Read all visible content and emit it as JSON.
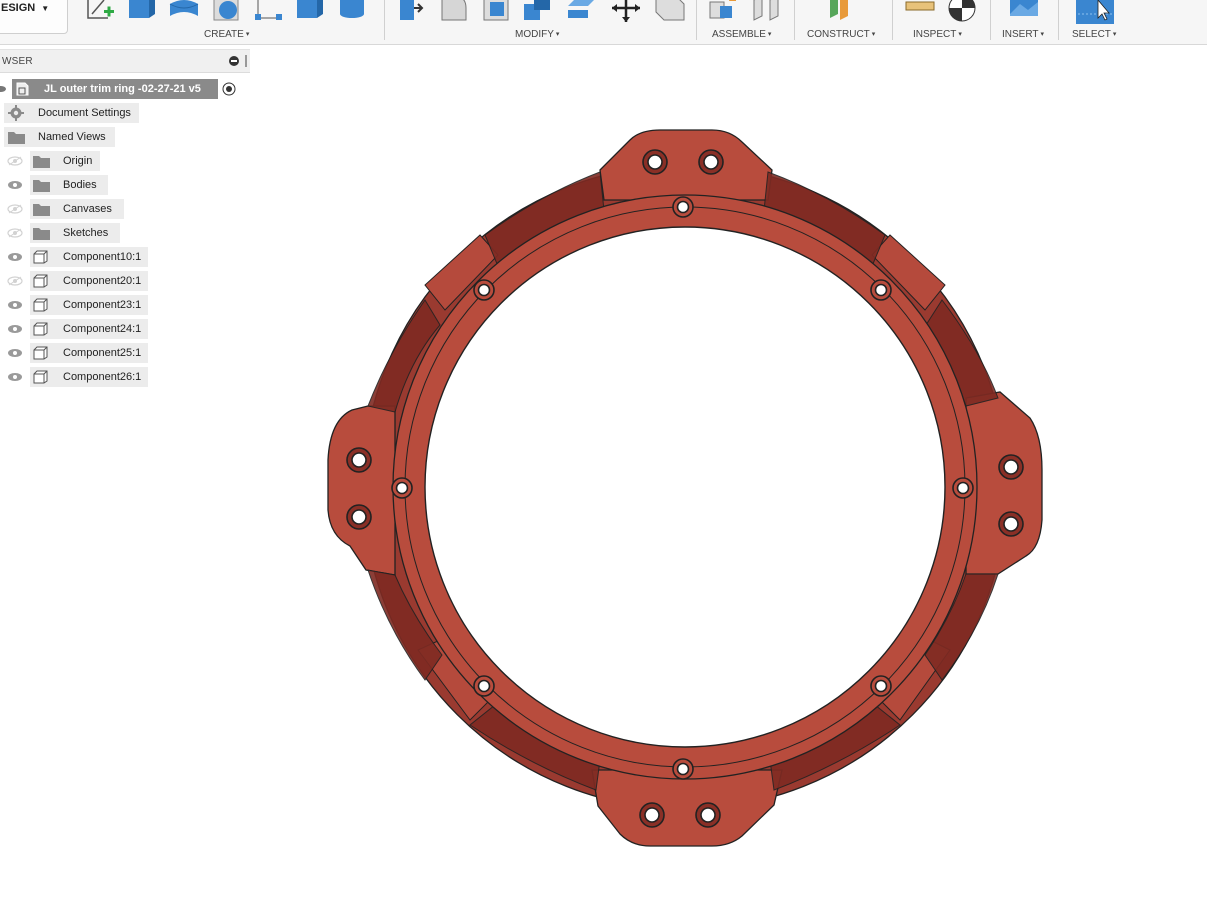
{
  "toolbar": {
    "workspace_label": "ESIGN",
    "groups": [
      {
        "label": "CREATE"
      },
      {
        "label": "MODIFY"
      },
      {
        "label": "ASSEMBLE"
      },
      {
        "label": "CONSTRUCT"
      },
      {
        "label": "INSPECT"
      },
      {
        "label": "INSERT"
      },
      {
        "label": "SELECT"
      }
    ],
    "caret": "▾"
  },
  "browser": {
    "title": "WSER",
    "root": "JL outer trim ring -02-27-21 v5",
    "items": [
      {
        "label": "Document Settings",
        "icon": "gear-icon"
      },
      {
        "label": "Named Views",
        "icon": "folder-icon"
      },
      {
        "label": "Origin",
        "icon": "folder-icon",
        "visible": false
      },
      {
        "label": "Bodies",
        "icon": "folder-icon",
        "visible": true
      },
      {
        "label": "Canvases",
        "icon": "folder-icon",
        "visible": false
      },
      {
        "label": "Sketches",
        "icon": "folder-icon",
        "visible": false
      },
      {
        "label": "Component10:1",
        "icon": "component-icon",
        "visible": true
      },
      {
        "label": "Component20:1",
        "icon": "component-icon",
        "visible": false
      },
      {
        "label": "Component23:1",
        "icon": "component-icon",
        "visible": true
      },
      {
        "label": "Component24:1",
        "icon": "component-icon",
        "visible": true
      },
      {
        "label": "Component25:1",
        "icon": "component-icon",
        "visible": true
      },
      {
        "label": "Component26:1",
        "icon": "component-icon",
        "visible": true
      }
    ]
  },
  "colors": {
    "ring": "#b84c3d",
    "ring_dark": "#8e3229",
    "accent_blue": "#3a86d0",
    "construct_green": "#56a65a",
    "construct_orange": "#e89a3a"
  }
}
